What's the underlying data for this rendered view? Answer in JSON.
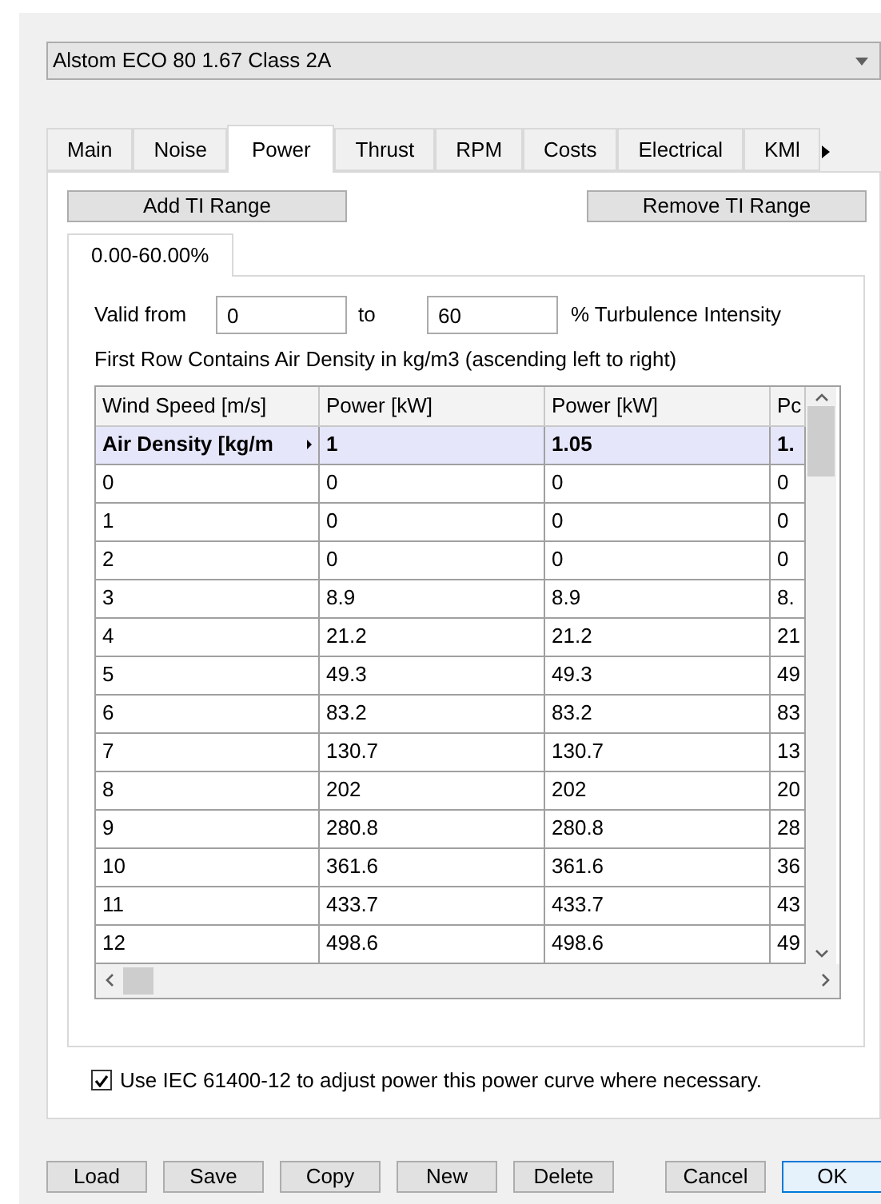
{
  "model_select": {
    "value": "Alstom ECO 80 1.67 Class 2A"
  },
  "tabs": [
    {
      "label": "Main",
      "selected": false
    },
    {
      "label": "Noise",
      "selected": false
    },
    {
      "label": "Power",
      "selected": true
    },
    {
      "label": "Thrust",
      "selected": false
    },
    {
      "label": "RPM",
      "selected": false
    },
    {
      "label": "Costs",
      "selected": false
    },
    {
      "label": "Electrical",
      "selected": false
    },
    {
      "label": "KMl",
      "selected": false
    }
  ],
  "power": {
    "add_button": "Add TI Range",
    "remove_button": "Remove TI Range",
    "ranges": [
      {
        "label": "0.00-60.00%",
        "selected": true
      }
    ],
    "valid_from": {
      "label": "Valid from",
      "value": "0"
    },
    "to": {
      "label": "to",
      "value": "60"
    },
    "unit": "% Turbulence Intensity",
    "note": "First Row Contains Air Density in kg/m3 (ascending left to right)",
    "table": {
      "columns": [
        "Wind Speed [m/s]",
        "Power [kW]",
        "Power [kW]",
        "Pc"
      ],
      "density_row": [
        "Air Density [kg/m",
        "1",
        "1.05",
        "1."
      ],
      "rows": [
        [
          "0",
          "0",
          "0",
          "0"
        ],
        [
          "1",
          "0",
          "0",
          "0"
        ],
        [
          "2",
          "0",
          "0",
          "0"
        ],
        [
          "3",
          "8.9",
          "8.9",
          "8."
        ],
        [
          "4",
          "21.2",
          "21.2",
          "21"
        ],
        [
          "5",
          "49.3",
          "49.3",
          "49"
        ],
        [
          "6",
          "83.2",
          "83.2",
          "83"
        ],
        [
          "7",
          "130.7",
          "130.7",
          "13"
        ],
        [
          "8",
          "202",
          "202",
          "20"
        ],
        [
          "9",
          "280.8",
          "280.8",
          "28"
        ],
        [
          "10",
          "361.6",
          "361.6",
          "36"
        ],
        [
          "11",
          "433.7",
          "433.7",
          "43"
        ],
        [
          "12",
          "498.6",
          "498.6",
          "49"
        ]
      ]
    },
    "iec": {
      "label": "Use IEC 61400-12 to adjust power this power curve where necessary.",
      "checked": true
    }
  },
  "left_buttons": [
    "Load",
    "Save",
    "Copy",
    "New",
    "Delete"
  ],
  "right_buttons": [
    {
      "label": "Cancel",
      "default": false
    },
    {
      "label": "OK",
      "default": true
    }
  ]
}
